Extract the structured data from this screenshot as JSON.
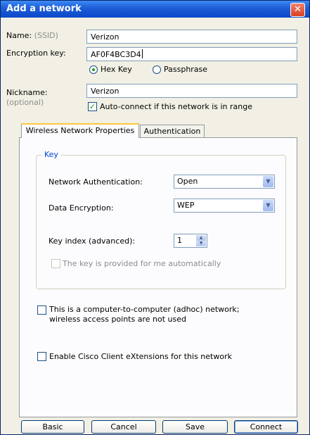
{
  "window": {
    "title": "Add a network"
  },
  "icons": {
    "close": "close-x-icon",
    "dropdown": "chevron-down-icon"
  },
  "form": {
    "name_label": "Name:",
    "name_hint": "(SSID)",
    "name_value": "Verizon",
    "encryption_label": "Encryption key:",
    "encryption_value": "AF0F4BC3D4",
    "radio_hex": "Hex Key",
    "radio_pass": "Passphrase",
    "selected_key_type": "Hex Key",
    "nickname_label": "Nickname:",
    "nickname_hint": "(optional)",
    "nickname_value": "Verizon",
    "autoconnect_label": "Auto-connect if this network is in range",
    "autoconnect_checked": true
  },
  "tabs": [
    {
      "label": "Wireless Network Properties",
      "active": true
    },
    {
      "label": "Authentication",
      "active": false
    }
  ],
  "key_group": {
    "title": "Key",
    "net_auth_label": "Network Authentication:",
    "net_auth_value": "Open",
    "data_enc_label": "Data Encryption:",
    "data_enc_value": "WEP",
    "key_index_label": "Key index (advanced):",
    "key_index_value": "1",
    "auto_key_label": "The key is provided for me automatically",
    "auto_key_checked": false
  },
  "options": {
    "adhoc_line1": "This is a computer-to-computer (adhoc) network;",
    "adhoc_line2": "wireless access points are not used",
    "adhoc_checked": false,
    "cisco_label": "Enable Cisco Client eXtensions for this network",
    "cisco_checked": false
  },
  "buttons": {
    "basic": "Basic",
    "cancel": "Cancel",
    "save": "Save",
    "connect": "Connect"
  },
  "colors": {
    "title_bar": "#1f5fd8",
    "close_button": "#d8401f",
    "group_title": "#0046d5",
    "check_mark": "#21a121"
  }
}
